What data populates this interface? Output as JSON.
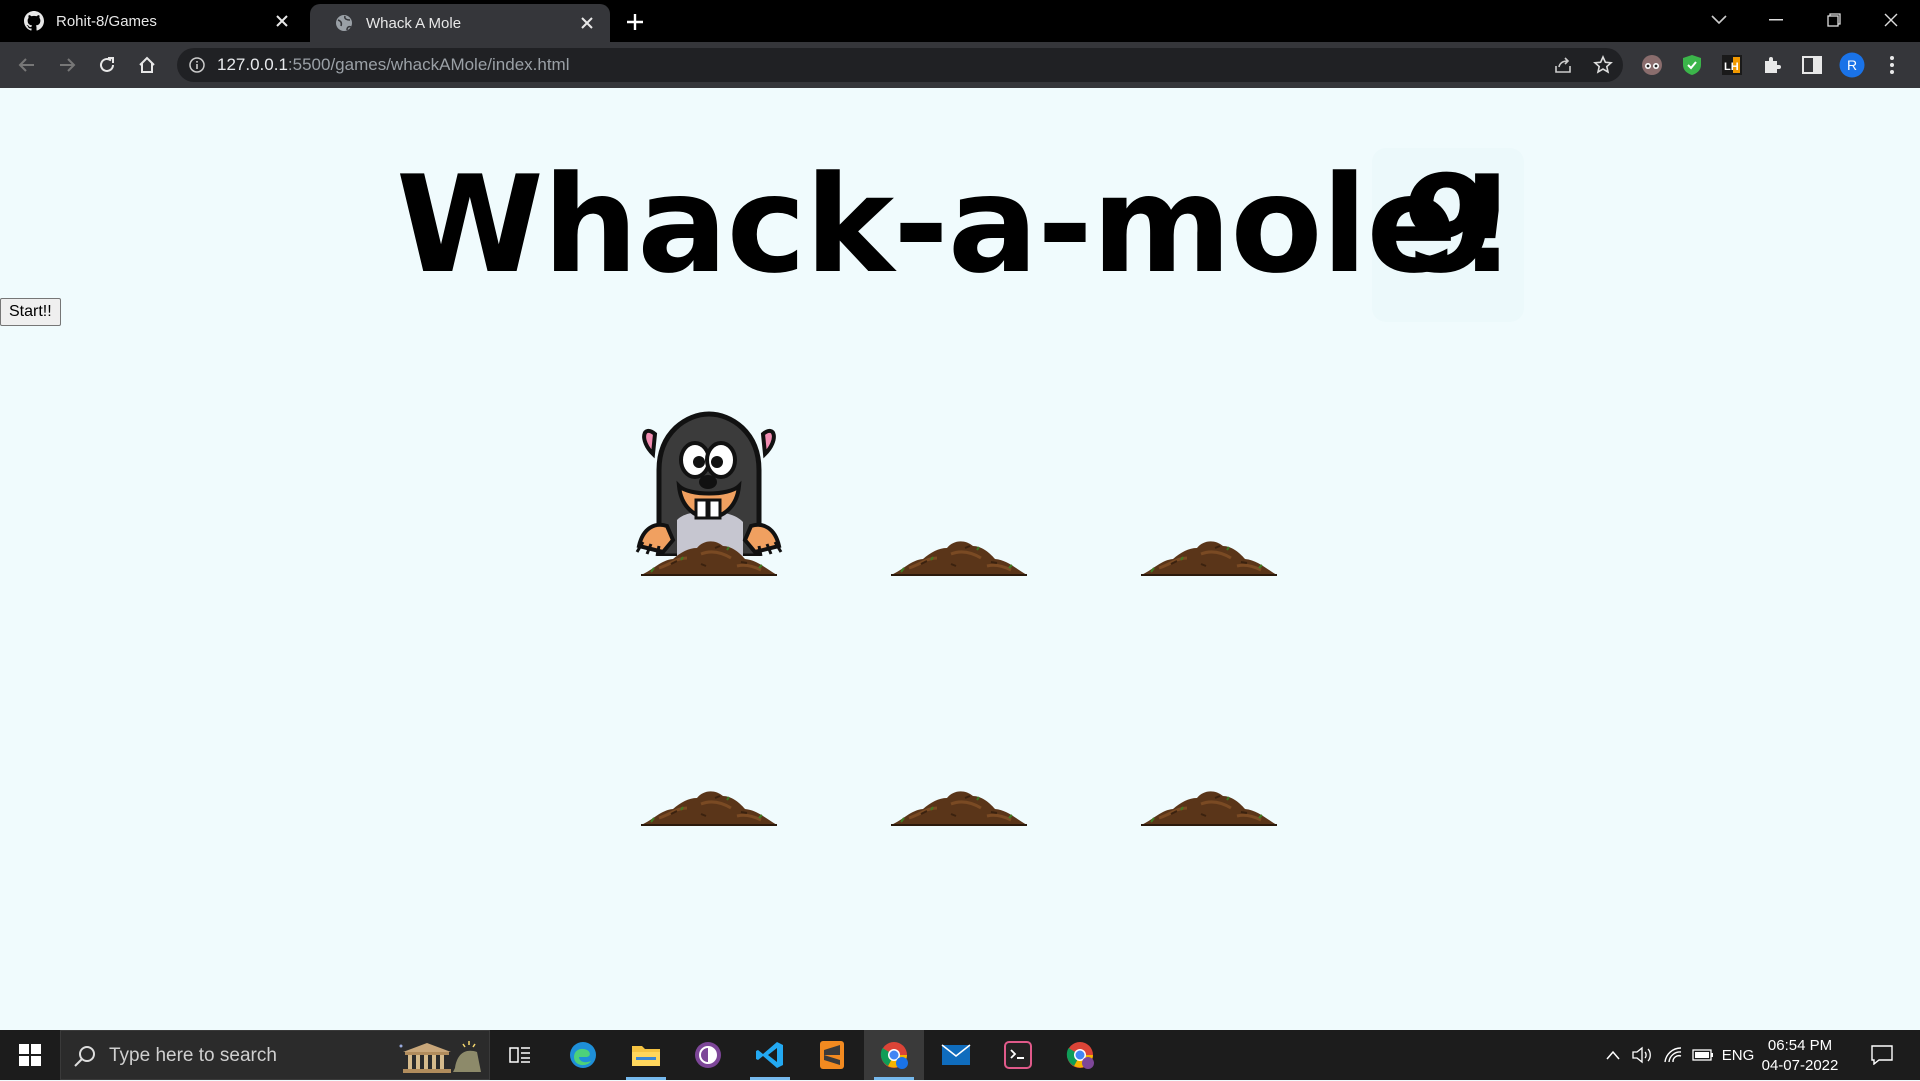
{
  "browser": {
    "tabs": [
      {
        "title": "Rohit-8/Games",
        "icon": "github-icon",
        "active": false
      },
      {
        "title": "Whack A Mole",
        "icon": "globe-icon",
        "active": true
      }
    ],
    "url_host": "127.0.0.1",
    "url_rest": ":5500/games/whackAMole/index.html",
    "profile_initial": "R",
    "lighthouse_label": "LH"
  },
  "page": {
    "title": "Whack-a-mole!",
    "score": "9",
    "start_label": "Start!!",
    "holes": [
      {
        "row": 1,
        "col": 1,
        "mole_visible": true
      },
      {
        "row": 1,
        "col": 2,
        "mole_visible": false
      },
      {
        "row": 1,
        "col": 3,
        "mole_visible": false
      },
      {
        "row": 2,
        "col": 1,
        "mole_visible": false
      },
      {
        "row": 2,
        "col": 2,
        "mole_visible": false
      },
      {
        "row": 2,
        "col": 3,
        "mole_visible": false
      }
    ]
  },
  "taskbar": {
    "search_placeholder": "Type here to search",
    "language": "ENG",
    "time": "06:54 PM",
    "date": "04-07-2022",
    "apps": [
      "task-view",
      "edge",
      "file-explorer",
      "tor-browser",
      "vscode",
      "sublime-text",
      "chrome",
      "mail",
      "terminal",
      "chrome-profile"
    ]
  },
  "colors": {
    "page_bg": "#f0fbfd",
    "tab_bg": "#000000",
    "toolbar_bg": "#35363a",
    "taskbar_bg": "#1c1c1c",
    "dirt": "#5a3519"
  }
}
